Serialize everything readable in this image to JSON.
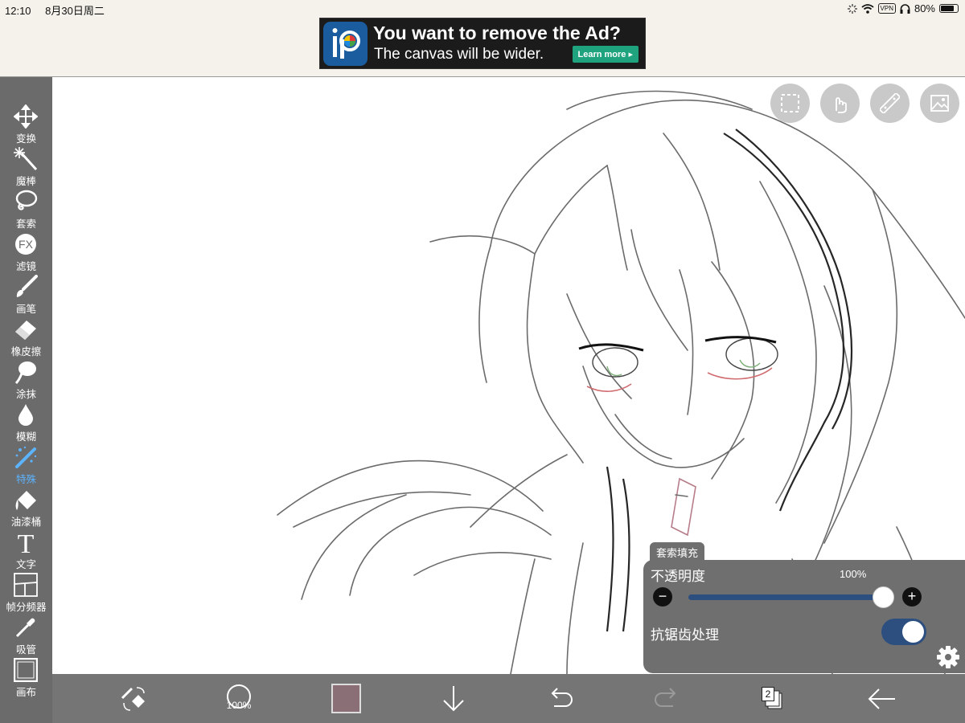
{
  "status_bar": {
    "time": "12:10",
    "date": "8月30日周二",
    "vpn": "VPN",
    "battery": "80%",
    "battery_level": 0.8
  },
  "ad": {
    "headline": "You want to remove the Ad?",
    "subline": "The canvas will be wider.",
    "cta": "Learn more ▸"
  },
  "toolbar": {
    "tools": [
      {
        "id": "transform",
        "label": "变换",
        "icon": "move-arrows-icon"
      },
      {
        "id": "magic-wand",
        "label": "魔棒",
        "icon": "magic-wand-icon"
      },
      {
        "id": "lasso",
        "label": "套索",
        "icon": "lasso-icon"
      },
      {
        "id": "filter",
        "label": "滤镜",
        "icon": "fx-icon",
        "icon_text": "FX"
      },
      {
        "id": "brush",
        "label": "画笔",
        "icon": "brush-icon"
      },
      {
        "id": "eraser",
        "label": "橡皮擦",
        "icon": "eraser-icon"
      },
      {
        "id": "smudge",
        "label": "涂抹",
        "icon": "smudge-icon"
      },
      {
        "id": "blur",
        "label": "模糊",
        "icon": "blur-drop-icon"
      },
      {
        "id": "special",
        "label": "特殊",
        "icon": "special-wand-icon",
        "active": true
      },
      {
        "id": "bucket",
        "label": "油漆桶",
        "icon": "paint-bucket-icon"
      },
      {
        "id": "text",
        "label": "文字",
        "icon": "text-icon",
        "icon_text": "T"
      },
      {
        "id": "frame-divider",
        "label": "帧分频器",
        "icon": "frame-divider-icon"
      },
      {
        "id": "eyedropper",
        "label": "吸管",
        "icon": "eyedropper-icon"
      },
      {
        "id": "canvas",
        "label": "画布",
        "icon": "canvas-icon"
      }
    ],
    "active_color": "#5cb3ff"
  },
  "floating_buttons": [
    "selection-icon",
    "touch-gesture-icon",
    "ruler-icon",
    "image-gallery-icon"
  ],
  "lasso_panel": {
    "title": "套索填充",
    "opacity_label": "不透明度",
    "opacity_value": "100%",
    "opacity_fraction": 1.0,
    "minus": "−",
    "plus": "+",
    "antialias_label": "抗锯齿处理",
    "antialias_on": true
  },
  "bottom_bar": {
    "brush_size_label": "100%",
    "current_color": "#8a6f77",
    "layer_count": "2"
  }
}
